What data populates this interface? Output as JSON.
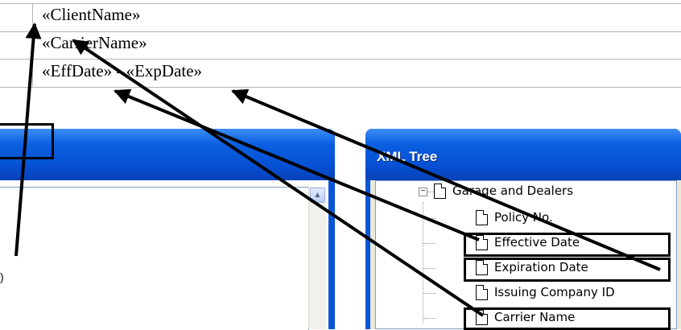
{
  "document": {
    "fields": [
      "«ClientName»",
      "«CarrierName»",
      "«EffDate» - «ExpDate»"
    ]
  },
  "left_window": {
    "cut_text": ")",
    "scroll_up_glyph": "▲"
  },
  "xml_tree": {
    "title": "XML Tree",
    "root": "Garage and Dealers",
    "expander_glyph": "−",
    "items": [
      "Policy No.",
      "Effective Date",
      "Expiration Date",
      "Issuing Company ID",
      "Carrier Name"
    ]
  },
  "colors": {
    "titlebar_blue": "#0651d4",
    "arrow": "#000000",
    "grid_line": "#b5b5b5"
  },
  "icons": [
    "document-icon",
    "tree-expander-icon",
    "scroll-up-icon",
    "arrow-icon"
  ]
}
